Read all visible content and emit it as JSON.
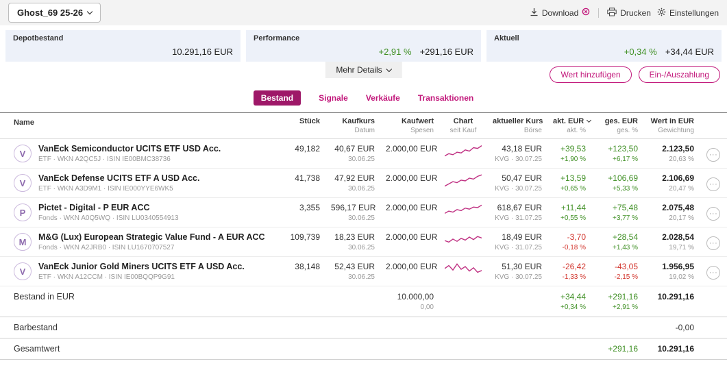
{
  "colors": {
    "accent": "#c2187b",
    "accent_dark": "#9e1868",
    "positive": "#3f8f24",
    "negative": "#d2342c",
    "spark": "#c03283"
  },
  "topbar": {
    "portfolio_selector": "Ghost_69 25-26",
    "download": "Download",
    "print": "Drucken",
    "settings": "Einstellungen"
  },
  "summary_cards": [
    {
      "label": "Depotbestand",
      "pct": "",
      "value": "10.291,16 EUR"
    },
    {
      "label": "Performance",
      "pct": "+2,91 %",
      "value": "+291,16 EUR"
    },
    {
      "label": "Aktuell",
      "pct": "+0,34 %",
      "value": "+34,44 EUR"
    }
  ],
  "more_details_label": "Mehr Details",
  "action_buttons": {
    "add_value": "Wert hinzufügen",
    "payment": "Ein-/Auszahlung"
  },
  "tabs": [
    {
      "label": "Bestand",
      "state": "active"
    },
    {
      "label": "Signale",
      "state": ""
    },
    {
      "label": "Verkäufe",
      "state": ""
    },
    {
      "label": "Transaktionen",
      "state": ""
    }
  ],
  "table": {
    "header": {
      "name": "Name",
      "stueck": "Stück",
      "kaufkurs": "Kaufkurs",
      "kaufkurs_sub": "Datum",
      "kaufwert": "Kaufwert",
      "kaufwert_sub": "Spesen",
      "chart": "Chart",
      "chart_sub": "seit Kauf",
      "kurs": "aktueller Kurs",
      "kurs_sub": "Börse",
      "akt": "akt. EUR",
      "akt_sub": "akt. %",
      "ges": "ges. EUR",
      "ges_sub": "ges. %",
      "wert": "Wert in EUR",
      "wert_sub": "Gewichtung"
    },
    "rows": [
      {
        "avatar": "V",
        "name": "VanEck Semiconductor UCITS ETF USD Acc.",
        "subtitle": "ETF · WKN A2QC5J · ISIN IE00BMC38736",
        "stueck": "49,182",
        "kaufkurs": "40,67 EUR",
        "kauf_datum": "30.06.25",
        "kaufwert": "2.000,00 EUR",
        "spark": [
          20,
          35,
          28,
          45,
          40,
          60,
          52,
          75,
          70,
          88
        ],
        "kurs": "43,18 EUR",
        "boerse": "KVG · 30.07.25",
        "akt_eur": "+39,53",
        "akt_pct": "+1,90 %",
        "akt_dir": "pos",
        "ges_eur": "+123,50",
        "ges_pct": "+6,17 %",
        "ges_dir": "pos",
        "wert": "2.123,50",
        "gewichtung": "20,63 %"
      },
      {
        "avatar": "V",
        "name": "VanEck Defense UCITS ETF A USD Acc.",
        "subtitle": "ETF · WKN A3D9M1 · ISIN IE000YYE6WK5",
        "stueck": "41,738",
        "kaufkurs": "47,92 EUR",
        "kauf_datum": "30.06.25",
        "kaufwert": "2.000,00 EUR",
        "spark": [
          15,
          30,
          45,
          38,
          55,
          50,
          68,
          62,
          80,
          90
        ],
        "kurs": "50,47 EUR",
        "boerse": "KVG · 30.07.25",
        "akt_eur": "+13,59",
        "akt_pct": "+0,65 %",
        "akt_dir": "pos",
        "ges_eur": "+106,69",
        "ges_pct": "+5,33 %",
        "ges_dir": "pos",
        "wert": "2.106,69",
        "gewichtung": "20,47 %"
      },
      {
        "avatar": "P",
        "name": "Pictet - Digital - P EUR ACC",
        "subtitle": "Fonds · WKN A0Q5WQ · ISIN LU0340554913",
        "stueck": "3,355",
        "kaufkurs": "596,17 EUR",
        "kauf_datum": "30.06.25",
        "kaufwert": "2.000,00 EUR",
        "spark": [
          30,
          45,
          38,
          55,
          48,
          65,
          58,
          72,
          68,
          85
        ],
        "kurs": "618,67 EUR",
        "boerse": "KVG · 31.07.25",
        "akt_eur": "+11,44",
        "akt_pct": "+0,55 %",
        "akt_dir": "pos",
        "ges_eur": "+75,48",
        "ges_pct": "+3,77 %",
        "ges_dir": "pos",
        "wert": "2.075,48",
        "gewichtung": "20,17 %"
      },
      {
        "avatar": "M",
        "name": "M&G (Lux) European Strategic Value Fund - A EUR ACC",
        "subtitle": "Fonds · WKN A2JRB0 · ISIN LU1670707527",
        "stueck": "109,739",
        "kaufkurs": "18,23 EUR",
        "kauf_datum": "30.06.25",
        "kaufwert": "2.000,00 EUR",
        "spark": [
          45,
          35,
          55,
          40,
          60,
          48,
          68,
          52,
          72,
          62
        ],
        "kurs": "18,49 EUR",
        "boerse": "KVG · 31.07.25",
        "akt_eur": "-3,70",
        "akt_pct": "-0,18 %",
        "akt_dir": "neg",
        "ges_eur": "+28,54",
        "ges_pct": "+1,43 %",
        "ges_dir": "pos",
        "wert": "2.028,54",
        "gewichtung": "19,71 %"
      },
      {
        "avatar": "V",
        "name": "VanEck Junior Gold Miners UCITS ETF A USD Acc.",
        "subtitle": "ETF · WKN A12CCM · ISIN IE00BQQP9G91",
        "stueck": "38,148",
        "kaufkurs": "52,43 EUR",
        "kauf_datum": "30.06.25",
        "kaufwert": "2.000,00 EUR",
        "spark": [
          55,
          75,
          45,
          85,
          50,
          68,
          38,
          60,
          30,
          42
        ],
        "kurs": "51,30 EUR",
        "boerse": "KVG · 30.07.25",
        "akt_eur": "-26,42",
        "akt_pct": "-1,33 %",
        "akt_dir": "neg",
        "ges_eur": "-43,05",
        "ges_pct": "-2,15 %",
        "ges_dir": "neg",
        "wert": "1.956,95",
        "gewichtung": "19,02 %"
      }
    ]
  },
  "totals": {
    "bestand": {
      "label": "Bestand in EUR",
      "kaufwert": "10.000,00",
      "spesen": "0,00",
      "akt_eur": "+34,44",
      "akt_pct": "+0,34 %",
      "ges_eur": "+291,16",
      "ges_pct": "+2,91 %",
      "wert": "10.291,16"
    },
    "barbestand": {
      "label": "Barbestand",
      "wert": "-0,00"
    },
    "gesamtwert": {
      "label": "Gesamtwert",
      "ges_eur": "+291,16",
      "wert": "10.291,16"
    }
  }
}
